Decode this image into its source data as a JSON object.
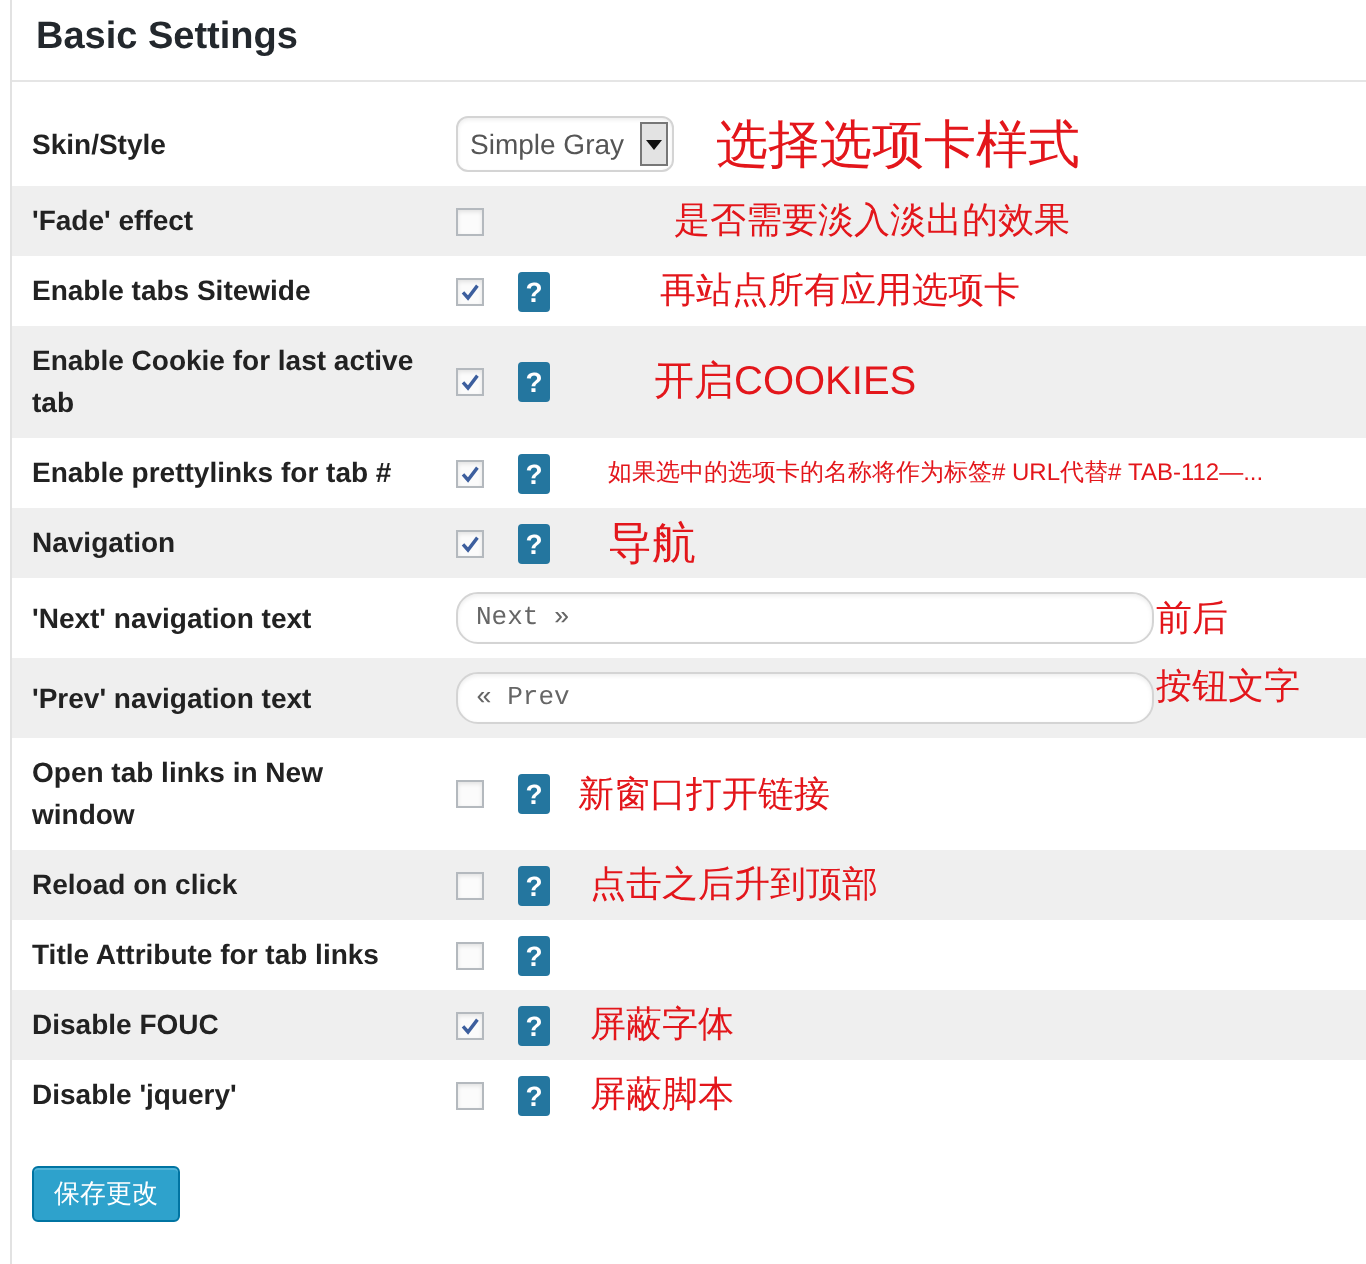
{
  "title": "Basic Settings",
  "rows": [
    {
      "label": "Skin/Style",
      "kind": "select",
      "value": "Simple Gray",
      "note": "选择选项卡样式"
    },
    {
      "label": "'Fade' effect",
      "kind": "checkbox",
      "checked": false,
      "note": "是否需要淡入淡出的效果"
    },
    {
      "label": "Enable tabs Sitewide",
      "kind": "checkbox",
      "checked": true,
      "help": "?",
      "note": "再站点所有应用选项卡"
    },
    {
      "label": "Enable Cookie for last active tab",
      "kind": "checkbox",
      "checked": true,
      "help": "?",
      "note": "开启COOKIES"
    },
    {
      "label": "Enable prettylinks for tab #",
      "kind": "checkbox",
      "checked": true,
      "help": "?",
      "note": "如果选中的选项卡的名称将作为标签# URL代替# TAB-112—..."
    },
    {
      "label": "Navigation",
      "kind": "checkbox",
      "checked": true,
      "help": "?",
      "note": "导航"
    },
    {
      "label": "'Next' navigation text",
      "kind": "text",
      "value": "Next »",
      "note": "前后"
    },
    {
      "label": "'Prev' navigation text",
      "kind": "text",
      "value": "« Prev",
      "note": "按钮文字"
    },
    {
      "label": "Open tab links in New window",
      "kind": "checkbox",
      "checked": false,
      "help": "?",
      "note": "新窗口打开链接"
    },
    {
      "label": "Reload on click",
      "kind": "checkbox",
      "checked": false,
      "help": "?",
      "note": "点击之后升到顶部"
    },
    {
      "label": "Title Attribute for tab links",
      "kind": "checkbox",
      "checked": false,
      "help": "?"
    },
    {
      "label": "Disable FOUC",
      "kind": "checkbox",
      "checked": true,
      "help": "?",
      "note": "屏蔽字体"
    },
    {
      "label": "Disable 'jquery'",
      "kind": "checkbox",
      "checked": false,
      "help": "?",
      "note": "屏蔽脚本"
    }
  ],
  "save_button": "保存更改"
}
